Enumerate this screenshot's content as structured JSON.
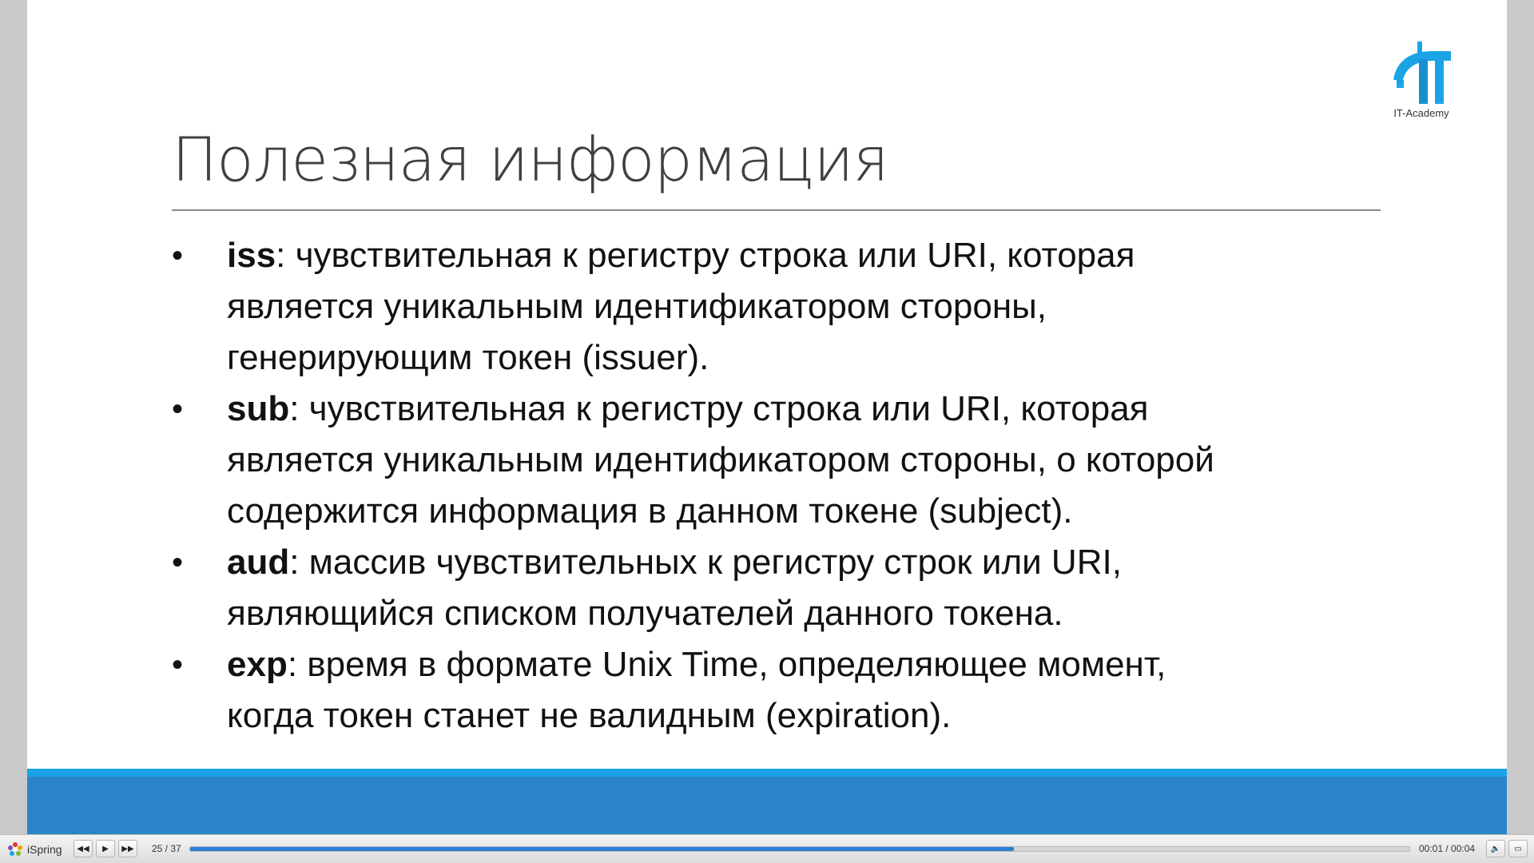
{
  "slide": {
    "title": "Полезная информация",
    "logo_text": "IT-Academy",
    "bullet_symbol": "•",
    "items": [
      {
        "term": "iss",
        "lines": [
          ": чувствительная к регистру строка или URI, которая",
          "является уникальным идентификатором стороны,",
          "генерирующим токен (issuer)."
        ]
      },
      {
        "term": "sub",
        "lines": [
          ": чувствительная к регистру строка или URI, которая",
          "является уникальным идентификатором стороны, о которой",
          "содержится информация в данном токене (subject)."
        ]
      },
      {
        "term": "aud",
        "lines": [
          ": массив чувствительных к регистру строк или URI,",
          "являющийся списком получателей данного токена."
        ]
      },
      {
        "term": "exp",
        "lines": [
          ": время в формате Unix Time, определяющее момент,",
          "когда токен станет не валидным (expiration)."
        ]
      }
    ]
  },
  "player": {
    "brand": "iSpring",
    "slide_counter": "25 / 37",
    "current_slide": 25,
    "total_slides": 37,
    "time": "00:01 / 00:04",
    "icons": {
      "prev": "rewind-icon",
      "play": "play-icon",
      "next": "fast-forward-icon",
      "volume": "volume-icon",
      "fullscreen": "fullscreen-icon"
    }
  },
  "colors": {
    "accent_light": "#1aa4e6",
    "accent_dark": "#2b84c8",
    "progress": "#2b7fd4"
  }
}
